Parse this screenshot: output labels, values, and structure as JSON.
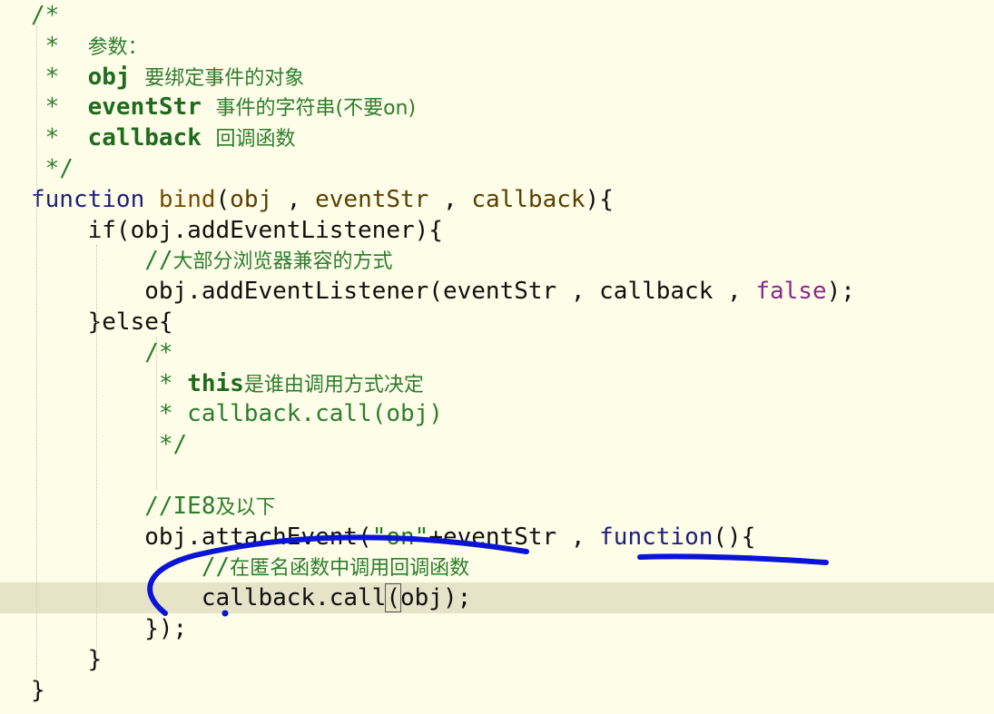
{
  "code_lines": [
    {
      "seg": [
        {
          "t": "/*",
          "c": "cm"
        }
      ]
    },
    {
      "seg": [
        {
          "t": " *  ",
          "c": "cm"
        },
        {
          "t": "参数：",
          "c": "cm cjk"
        }
      ]
    },
    {
      "seg": [
        {
          "t": " *  ",
          "c": "cm"
        },
        {
          "t": "obj ",
          "c": "cm-b"
        },
        {
          "t": "要绑定事件的对象",
          "c": "cm cjk"
        }
      ]
    },
    {
      "seg": [
        {
          "t": " *  ",
          "c": "cm"
        },
        {
          "t": "eventStr ",
          "c": "cm-b"
        },
        {
          "t": "事件的字符串(不要on)",
          "c": "cm cjk"
        }
      ]
    },
    {
      "seg": [
        {
          "t": " *  ",
          "c": "cm"
        },
        {
          "t": "callback ",
          "c": "cm-b"
        },
        {
          "t": "回调函数",
          "c": "cm cjk"
        }
      ]
    },
    {
      "seg": [
        {
          "t": " */",
          "c": "cm"
        }
      ]
    },
    {
      "seg": [
        {
          "t": "function ",
          "c": "kw"
        },
        {
          "t": "bind",
          "c": "fn"
        },
        {
          "t": "(",
          "c": ""
        },
        {
          "t": "obj",
          "c": "param"
        },
        {
          "t": " , ",
          "c": ""
        },
        {
          "t": "eventStr",
          "c": "param"
        },
        {
          "t": " , ",
          "c": ""
        },
        {
          "t": "callback",
          "c": "param"
        },
        {
          "t": "){",
          "c": ""
        }
      ]
    },
    {
      "seg": [
        {
          "t": "    if(obj.addEventListener){",
          "c": ""
        }
      ]
    },
    {
      "seg": [
        {
          "t": "        //",
          "c": "cm"
        },
        {
          "t": "大部分浏览器兼容的方式",
          "c": "cm cjk"
        }
      ]
    },
    {
      "seg": [
        {
          "t": "        obj.addEventListener(eventStr , callback , ",
          "c": ""
        },
        {
          "t": "false",
          "c": "bool"
        },
        {
          "t": ");",
          "c": ""
        }
      ]
    },
    {
      "seg": [
        {
          "t": "    }else{",
          "c": ""
        }
      ]
    },
    {
      "seg": [
        {
          "t": "        /*",
          "c": "cm"
        }
      ]
    },
    {
      "seg": [
        {
          "t": "         * ",
          "c": "cm"
        },
        {
          "t": "this",
          "c": "cm-b"
        },
        {
          "t": "是谁由调用方式决定",
          "c": "cm cjk"
        }
      ]
    },
    {
      "seg": [
        {
          "t": "         * callback.call(obj)",
          "c": "cm"
        }
      ]
    },
    {
      "seg": [
        {
          "t": "         */",
          "c": "cm"
        }
      ]
    },
    {
      "seg": [
        {
          "t": "",
          "c": ""
        }
      ]
    },
    {
      "seg": [
        {
          "t": "        //IE8",
          "c": "cm"
        },
        {
          "t": "及以下",
          "c": "cm cjk"
        }
      ]
    },
    {
      "seg": [
        {
          "t": "        obj.attachEvent(",
          "c": ""
        },
        {
          "t": "\"on\"",
          "c": "str"
        },
        {
          "t": "+eventStr , ",
          "c": ""
        },
        {
          "t": "function",
          "c": "kw"
        },
        {
          "t": "(){",
          "c": ""
        }
      ]
    },
    {
      "seg": [
        {
          "t": "            //",
          "c": "cm"
        },
        {
          "t": "在匿名函数中调用回调函数",
          "c": "cm cjk"
        }
      ]
    },
    {
      "seg": [
        {
          "t": "            callback.call",
          "c": ""
        },
        {
          "t": "(",
          "c": "bracket"
        },
        {
          "t": "obj);",
          "c": ""
        }
      ],
      "current": true
    },
    {
      "seg": [
        {
          "t": "        });",
          "c": ""
        }
      ]
    },
    {
      "seg": [
        {
          "t": "    }",
          "c": ""
        }
      ]
    },
    {
      "seg": [
        {
          "t": "}",
          "c": ""
        }
      ]
    }
  ],
  "colors": {
    "background": "#fdfde8",
    "current_line": "#e5e3c8",
    "ink": "#0a14d6"
  }
}
